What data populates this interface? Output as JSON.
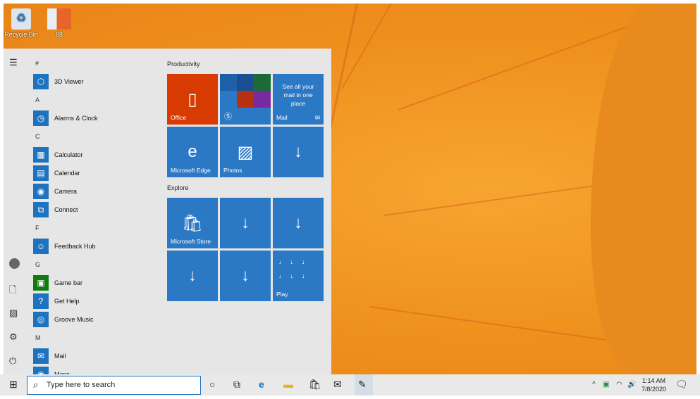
{
  "desktop": {
    "icons": [
      {
        "label": "Recycle Bin"
      },
      {
        "label": "88"
      }
    ]
  },
  "start": {
    "rail": [
      "menu-icon",
      "user-icon",
      "document-icon",
      "pictures-icon",
      "settings-icon",
      "power-icon"
    ],
    "apps": [
      {
        "type": "header",
        "label": "#"
      },
      {
        "type": "app",
        "label": "3D Viewer",
        "glyph": "⬡"
      },
      {
        "type": "header",
        "label": "A"
      },
      {
        "type": "app",
        "label": "Alarms & Clock",
        "glyph": "◷"
      },
      {
        "type": "header",
        "label": "C"
      },
      {
        "type": "app",
        "label": "Calculator",
        "glyph": "▦"
      },
      {
        "type": "app",
        "label": "Calendar",
        "glyph": "▤"
      },
      {
        "type": "app",
        "label": "Camera",
        "glyph": "◉"
      },
      {
        "type": "app",
        "label": "Connect",
        "glyph": "⧉"
      },
      {
        "type": "header",
        "label": "F"
      },
      {
        "type": "app",
        "label": "Feedback Hub",
        "glyph": "☺"
      },
      {
        "type": "header",
        "label": "G"
      },
      {
        "type": "app",
        "label": "Game bar",
        "glyph": "▣",
        "color": "#107c10"
      },
      {
        "type": "app",
        "label": "Get Help",
        "glyph": "?"
      },
      {
        "type": "app",
        "label": "Groove Music",
        "glyph": "◎"
      },
      {
        "type": "header",
        "label": "M"
      },
      {
        "type": "app",
        "label": "Mail",
        "glyph": "✉"
      },
      {
        "type": "app",
        "label": "Maps",
        "glyph": "◉"
      }
    ],
    "groups": {
      "productivity": "Productivity",
      "explore": "Explore"
    },
    "tiles": {
      "office": "Office",
      "mail_promo": "See all your mail in one place",
      "mail": "Mail",
      "edge": "Microsoft Edge",
      "photos": "Photos",
      "store": "Microsoft Store",
      "play": "Play"
    }
  },
  "taskbar": {
    "search_placeholder": "Type here to search",
    "time": "1:14 AM",
    "date": "7/8/2020"
  },
  "colors": {
    "office": "#d83b01",
    "tile": "#2b78c5"
  }
}
